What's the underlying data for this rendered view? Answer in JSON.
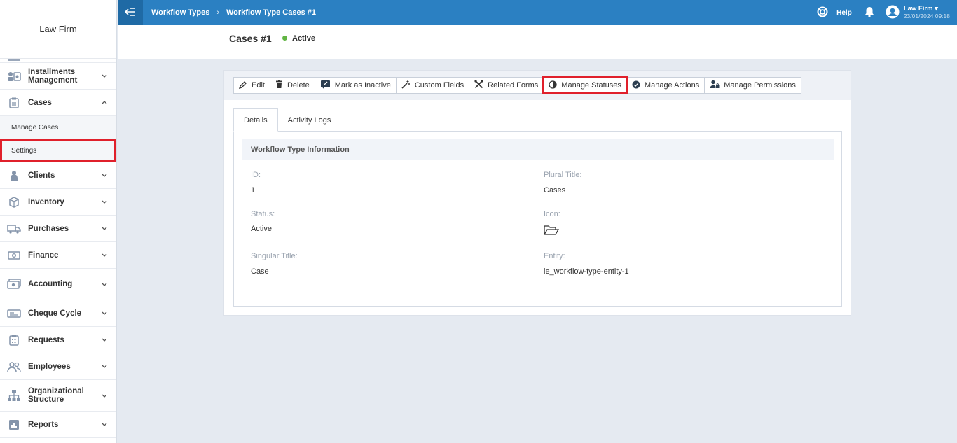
{
  "app": {
    "brand": "Law Firm"
  },
  "topbar": {
    "breadcrumb": [
      "Workflow Types",
      "Workflow Type Cases #1"
    ],
    "separator": "›",
    "help": "Help",
    "user_name": "Law Firm ▾",
    "user_datetime": "23/01/2024 09:18"
  },
  "sidebar": {
    "items": [
      {
        "label": "Installments Management",
        "icon": "installments-icon",
        "chevron": "down"
      },
      {
        "label": "Cases",
        "icon": "clipboard-icon",
        "chevron": "up"
      },
      {
        "label": "Clients",
        "icon": "clients-icon",
        "chevron": "down"
      },
      {
        "label": "Inventory",
        "icon": "box-icon",
        "chevron": "down"
      },
      {
        "label": "Purchases",
        "icon": "truck-icon",
        "chevron": "down"
      },
      {
        "label": "Finance",
        "icon": "money-icon",
        "chevron": "down"
      },
      {
        "label": "Accounting",
        "icon": "cash-icon",
        "chevron": "down"
      },
      {
        "label": "Cheque Cycle",
        "icon": "cheque-icon",
        "chevron": "down"
      },
      {
        "label": "Requests",
        "icon": "requests-icon",
        "chevron": "down"
      },
      {
        "label": "Employees",
        "icon": "employees-icon",
        "chevron": "down"
      },
      {
        "label": "Organizational Structure",
        "icon": "org-chart-icon",
        "chevron": "down"
      },
      {
        "label": "Reports",
        "icon": "reports-icon",
        "chevron": "down"
      }
    ],
    "cases_sub": [
      "Manage Cases",
      "Settings"
    ]
  },
  "page": {
    "title": "Cases #1",
    "status": "Active",
    "status_color": "#62b544"
  },
  "toolbar": {
    "buttons": [
      {
        "label": "Edit",
        "icon": "pencil-icon"
      },
      {
        "label": "Delete",
        "icon": "trash-icon"
      },
      {
        "label": "Mark as Inactive",
        "icon": "edit-box-icon"
      },
      {
        "label": "Custom Fields",
        "icon": "magic-wand-icon"
      },
      {
        "label": "Related Forms",
        "icon": "tools-icon"
      },
      {
        "label": "Manage Statuses",
        "icon": "half-circle-icon",
        "highlighted": true
      },
      {
        "label": "Manage Actions",
        "icon": "check-circle-icon"
      },
      {
        "label": "Manage Permissions",
        "icon": "user-lock-icon"
      }
    ]
  },
  "tabs": [
    "Details",
    "Activity Logs"
  ],
  "details": {
    "section_title": "Workflow Type Information",
    "fields": {
      "id_label": "ID:",
      "id_value": "1",
      "plural_label": "Plural Title:",
      "plural_value": "Cases",
      "status_label": "Status:",
      "status_value": "Active",
      "icon_label": "Icon:",
      "icon_value": "folder-open-icon",
      "singular_label": "Singular Title:",
      "singular_value": "Case",
      "entity_label": "Entity:",
      "entity_value": "le_workflow-type-entity-1"
    }
  },
  "colors": {
    "topbar": "#2b80c2",
    "highlight": "#e0202b"
  }
}
